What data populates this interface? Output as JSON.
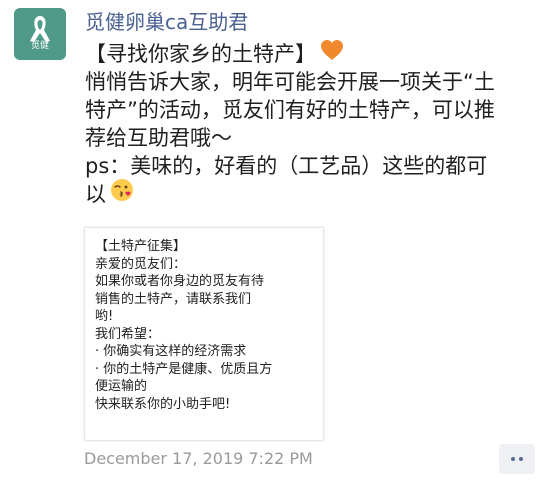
{
  "post": {
    "author": "觅健卵巢ca互助君",
    "avatar": {
      "text": "觅健",
      "color": "#4f9a88",
      "icon": "ribbon-icon"
    },
    "lines": [
      "【寻找你家乡的土特产】",
      "悄悄告诉大家，明年可能会开展一项关于“土",
      "特产”的活动，觅友们有好的土特产，可以推",
      "荐给互助君哦～",
      "ps：美味的，好看的（工艺品）这些的都可",
      "以"
    ],
    "emojis": {
      "heart": "orange-heart-emoji",
      "kiss": "face-blowing-kiss-emoji"
    },
    "image_card": {
      "lines": [
        "【土特产征集】",
        "亲爱的觅友们：",
        "如果你或者你身边的觅友有待",
        "销售的土特产，请联系我们",
        "哟!",
        "我们希望：",
        "· 你确实有这样的经济需求",
        "· 你的土特产是健康、优质且方",
        "便运输的",
        "快来联系你的小助手吧!"
      ]
    },
    "timestamp": "December 17, 2019 7:22 PM",
    "more_icon": "more-dots-icon",
    "colors": {
      "author": "#4a6191",
      "timestamp": "#9a9a9a",
      "heart": "#f0892e"
    }
  }
}
